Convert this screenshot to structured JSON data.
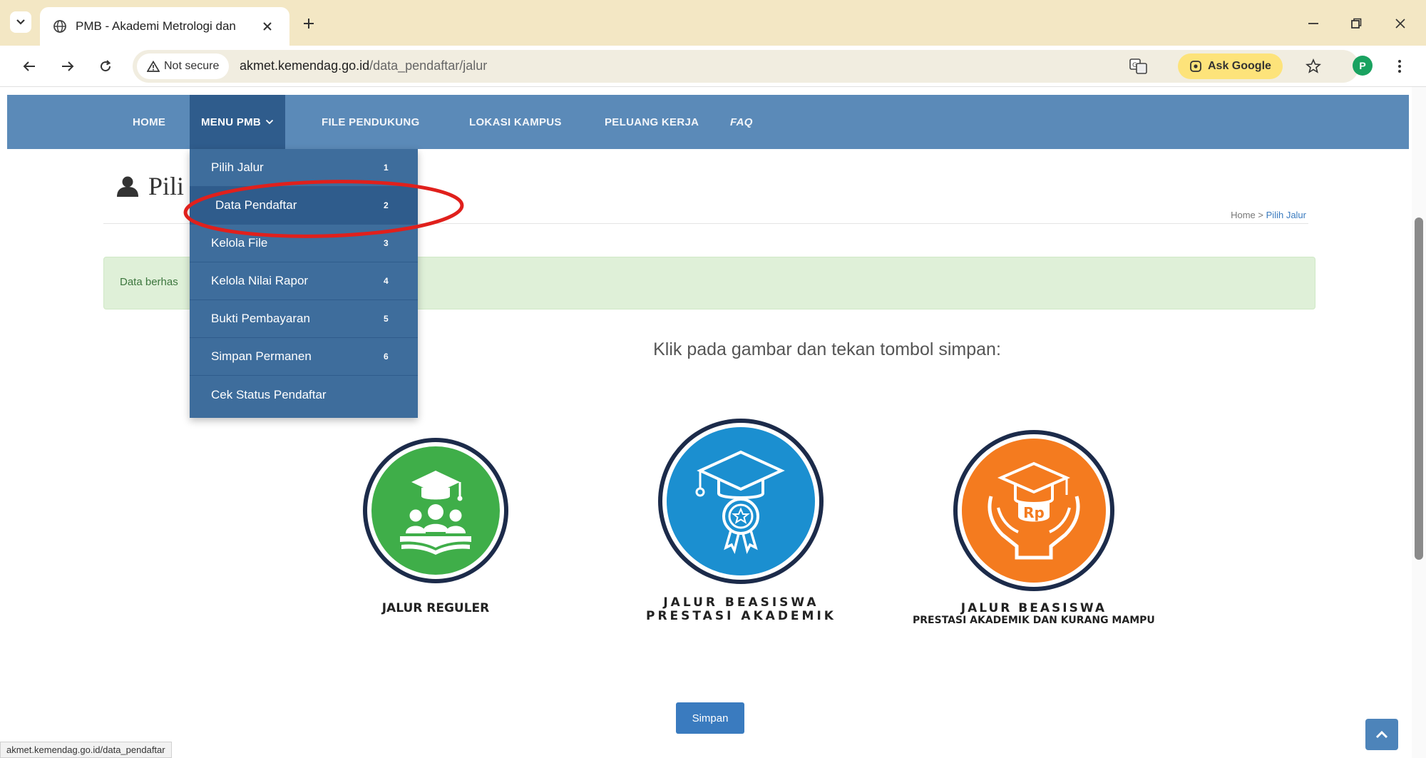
{
  "browser": {
    "tab_title": "PMB - Akademi Metrologi dan",
    "security_label": "Not secure",
    "url_host": "akmet.kemendag.go.id",
    "url_path": "/data_pendaftar/jalur",
    "ask_google_label": "Ask Google",
    "profile_initial": "P",
    "status_url": "akmet.kemendag.go.id/data_pendaftar"
  },
  "navbar": {
    "items": [
      {
        "label": "HOME"
      },
      {
        "label": "MENU PMB"
      },
      {
        "label": "FILE PENDUKUNG"
      },
      {
        "label": "LOKASI KAMPUS"
      },
      {
        "label": "PELUANG KERJA"
      },
      {
        "label": "FAQ"
      }
    ]
  },
  "dropdown": {
    "items": [
      {
        "label": "Pilih Jalur",
        "num": "1"
      },
      {
        "label": "Data Pendaftar",
        "num": "2"
      },
      {
        "label": "Kelola File",
        "num": "3"
      },
      {
        "label": "Kelola Nilai Rapor",
        "num": "4"
      },
      {
        "label": "Bukti Pembayaran",
        "num": "5"
      },
      {
        "label": "Simpan Permanen",
        "num": "6"
      },
      {
        "label": "Cek Status Pendaftar",
        "num": ""
      }
    ]
  },
  "page": {
    "title": "Pili",
    "breadcrumb_home": "Home",
    "breadcrumb_sep": ">",
    "breadcrumb_current": "Pilih Jalur",
    "alert": "Data berhas",
    "instruction": "Klik pada gambar dan tekan tombol simpan:",
    "save_button": "Simpan"
  },
  "options": [
    {
      "line1": "JALUR REGULER",
      "line2": ""
    },
    {
      "line1": "JALUR BEASISWA",
      "line2": "PRESTASI AKADEMIK"
    },
    {
      "line1": "JALUR BEASISWA",
      "line2": "PRESTASI AKADEMIK DAN KURANG MAMPU"
    }
  ],
  "colors": {
    "navbar": "#5b8ab8",
    "dropdown": "#3e6d9c",
    "regular_badge": "#3fae49",
    "academic_badge": "#1b8fd0",
    "need_badge": "#f47b1f",
    "badge_ring": "#1c2b4a",
    "annotation_ellipse": "#e0201c"
  },
  "icons": {
    "security": "warning-triangle-icon",
    "regular": "graduate-students-icon",
    "academic": "graduation-cap-medal-icon",
    "need": "graduation-cap-hands-rupiah-icon"
  }
}
